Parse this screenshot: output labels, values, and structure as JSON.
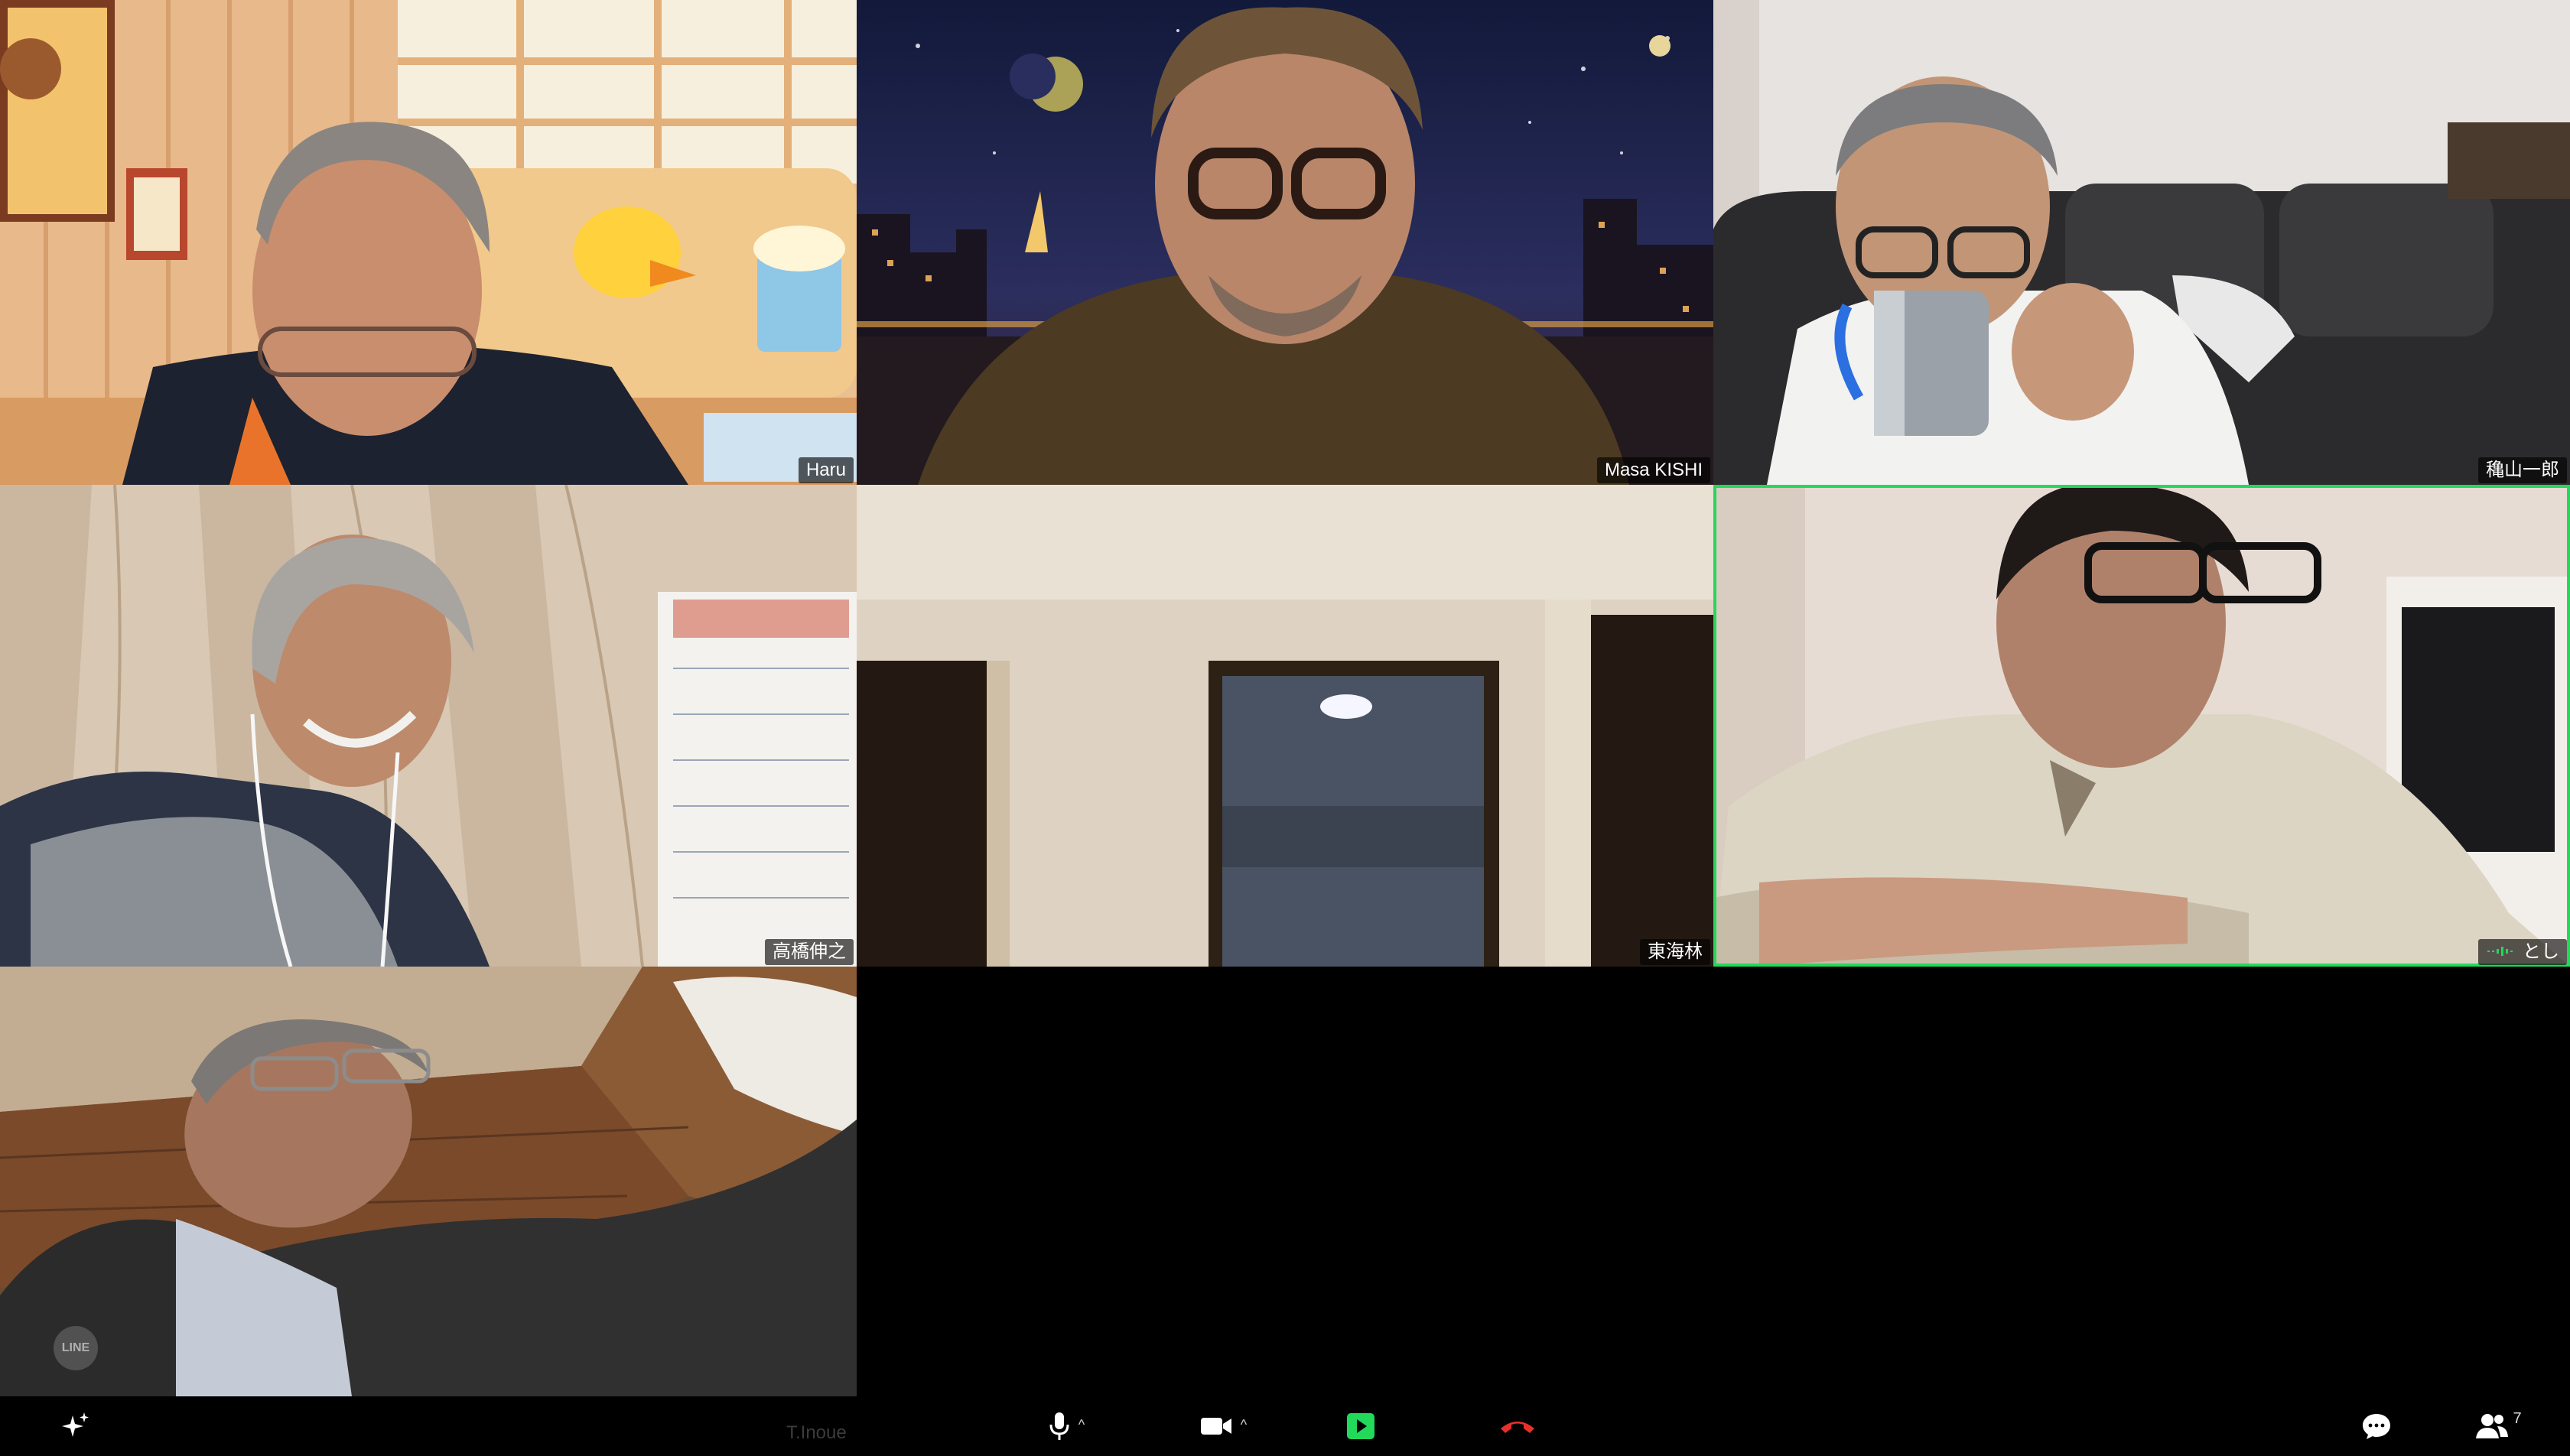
{
  "participants": [
    {
      "name": "Haru",
      "speaking": false
    },
    {
      "name": "Masa KISHI",
      "speaking": false
    },
    {
      "name": "穐山一郎",
      "speaking": false
    },
    {
      "name": "高橋伸之",
      "speaking": false
    },
    {
      "name": "東海林",
      "speaking": false
    },
    {
      "name": "とし",
      "speaking": true
    },
    {
      "name": "T.Inoue",
      "speaking": false
    }
  ],
  "toolbar": {
    "effects_icon": "sparkle-icon",
    "faint_label": "T.Inoue",
    "mic_icon": "microphone-icon",
    "mic_caret": "^",
    "video_icon": "video-camera-icon",
    "video_caret": "^",
    "share_icon": "share-screen-icon",
    "end_icon": "end-call-icon",
    "chat_icon": "chat-bubble-icon",
    "participants_icon": "participants-icon",
    "participants_count": "7"
  },
  "watermark": {
    "text": "LINE"
  },
  "colors": {
    "background": "#000000",
    "speaking_border": "#23d959",
    "share_green": "#23d959",
    "end_red": "#e8302a"
  }
}
